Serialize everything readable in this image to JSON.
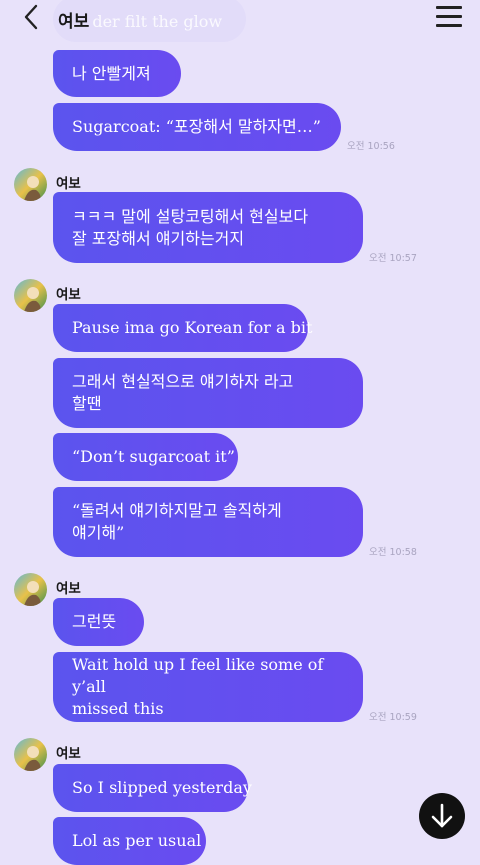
{
  "header": {
    "title": "여보"
  },
  "top_faded_text": "... der filt the glow",
  "messages_block1": [
    {
      "text": "나 안빨게져"
    },
    {
      "text": "Sugarcoat: “포장해서 말하자면…”"
    }
  ],
  "time1": "오전 10:56",
  "group2": {
    "sender": "여보",
    "lines": [
      "ㅋㅋㅋ 말에 설탕코팅해서 현실보다",
      "잘 포장해서 얘기하는거지"
    ],
    "time": "오전 10:57"
  },
  "group3": {
    "sender": "여보",
    "msg1": "Pause ima go Korean for a bit",
    "msg2_lines": [
      "그래서 현실적으로 얘기하자 라고",
      "할땐"
    ],
    "msg3": "“Don’t sugarcoat it”",
    "msg4_lines": [
      "“돌려서 얘기하지말고 솔직하게",
      "얘기해”"
    ],
    "time": "오전 10:58"
  },
  "group4": {
    "sender": "여보",
    "msg1": "그런뜻",
    "msg2_lines": [
      "Wait hold up I feel like some of y’all",
      "missed this"
    ],
    "time": "오전 10:59"
  },
  "group5": {
    "sender": "여보",
    "msg1": "So I slipped yesterday",
    "msg2": "Lol as per usual"
  }
}
